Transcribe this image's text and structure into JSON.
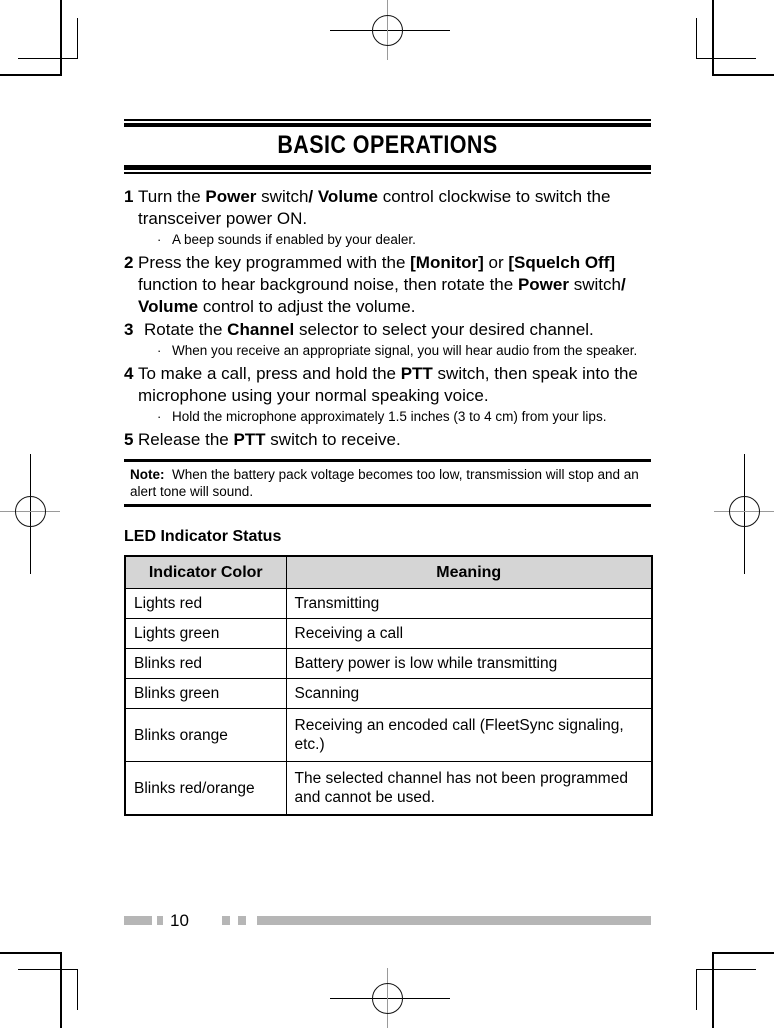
{
  "page": {
    "chapter_title": "BASIC OPERATIONS",
    "page_number": "10"
  },
  "steps": [
    {
      "num": "1",
      "segments": [
        {
          "t": "Turn the ",
          "b": false
        },
        {
          "t": "Power",
          "b": true
        },
        {
          "t": " switch",
          "b": false
        },
        {
          "t": "/ Volume",
          "b": true
        },
        {
          "t": " control clockwise to switch the transceiver power ON.",
          "b": false
        }
      ],
      "notes": [
        "A beep sounds if enabled by your dealer."
      ]
    },
    {
      "num": "2",
      "segments": [
        {
          "t": "Press the key programmed with the ",
          "b": false
        },
        {
          "t": "[Monitor]",
          "b": true
        },
        {
          "t": " or ",
          "b": false
        },
        {
          "t": "[Squelch Off]",
          "b": true
        },
        {
          "t": " function to hear background noise, then rotate the ",
          "b": false
        },
        {
          "t": "Power",
          "b": true
        },
        {
          "t": " switch",
          "b": false
        },
        {
          "t": "/ Volume",
          "b": true
        },
        {
          "t": " control to adjust the volume.",
          "b": false
        }
      ],
      "notes": []
    },
    {
      "num": "3",
      "segments": [
        {
          "t": "Rotate the ",
          "b": false
        },
        {
          "t": "Channel",
          "b": true
        },
        {
          "t": " selector to select your desired channel.",
          "b": false
        }
      ],
      "notes": [
        "When you receive an appropriate signal, you will hear audio from the speaker."
      ]
    },
    {
      "num": "4",
      "segments": [
        {
          "t": "To make a call, press and hold the ",
          "b": false
        },
        {
          "t": "PTT",
          "b": true
        },
        {
          "t": " switch, then speak into the microphone using your normal speaking voice.",
          "b": false
        }
      ],
      "notes": [
        "Hold the microphone approximately 1.5 inches (3 to 4 cm) from your lips."
      ]
    },
    {
      "num": "5",
      "segments": [
        {
          "t": "Release the ",
          "b": false
        },
        {
          "t": "PTT",
          "b": true
        },
        {
          "t": " switch to receive.",
          "b": false
        }
      ],
      "notes": []
    }
  ],
  "note_box": {
    "label": "Note:",
    "text": "When the battery pack voltage becomes too low, transmission will stop and an alert tone will sound."
  },
  "led_section": {
    "heading": "LED Indicator Status",
    "columns": [
      "Indicator Color",
      "Meaning"
    ],
    "rows": [
      {
        "color": "Lights red",
        "meaning": "Transmitting",
        "two_line": false
      },
      {
        "color": "Lights green",
        "meaning": "Receiving a call",
        "two_line": false
      },
      {
        "color": "Blinks red",
        "meaning": "Battery power is low while transmitting",
        "two_line": false
      },
      {
        "color": "Blinks green",
        "meaning": "Scanning",
        "two_line": false
      },
      {
        "color": "Blinks orange",
        "meaning": "Receiving an encoded call (FleetSync signaling, etc.)",
        "two_line": true
      },
      {
        "color": "Blinks red/orange",
        "meaning": "The selected channel has not been programmed and cannot be used.",
        "two_line": true
      }
    ]
  },
  "colors": {
    "ink": "#000000",
    "table_header_fill": "#d5d5d5",
    "footer_bar": "#b6b6b6"
  },
  "bullet_glyph": "·"
}
